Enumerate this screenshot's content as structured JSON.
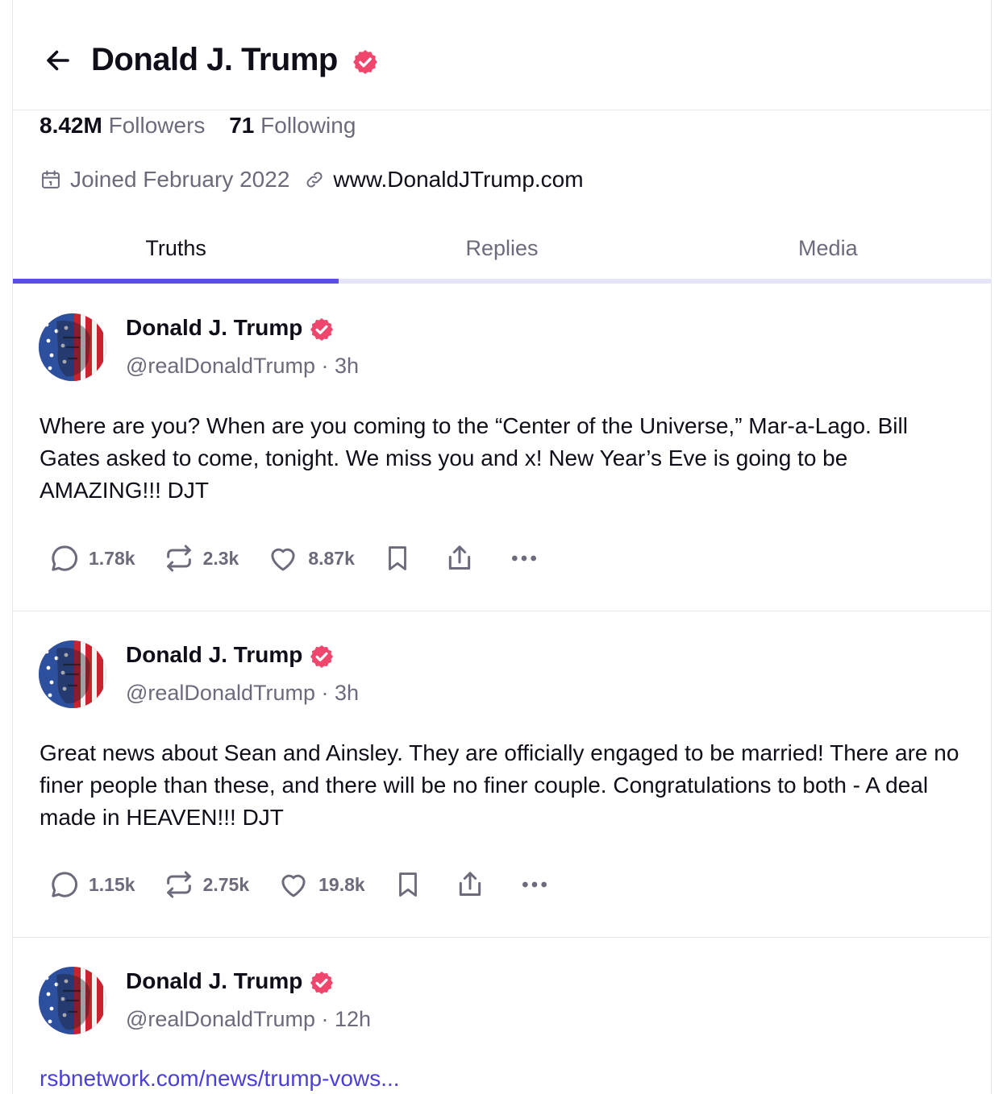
{
  "profile": {
    "display_name": "Donald J. Trump",
    "followers_count": "8.42M",
    "followers_label": "Followers",
    "following_count": "71",
    "following_label": "Following",
    "joined": "Joined February 2022",
    "website": "www.DonaldJTrump.com"
  },
  "tabs": [
    {
      "label": "Truths",
      "active": true
    },
    {
      "label": "Replies",
      "active": false
    },
    {
      "label": "Media",
      "active": false
    }
  ],
  "colors": {
    "accent": "#5b4fe0",
    "verified": "#f0456d",
    "link": "#4b3fd6"
  },
  "posts": [
    {
      "author": "Donald J. Trump",
      "handle_time": "@realDonaldTrump · 3h",
      "text": "Where are you? When are you coming to the “Center of the Universe,” Mar-a-Lago. Bill Gates asked to come, tonight. We miss you and x! New Year’s Eve is going to be AMAZING!!!  DJT",
      "replies": "1.78k",
      "retruths": "2.3k",
      "likes": "8.87k"
    },
    {
      "author": "Donald J. Trump",
      "handle_time": "@realDonaldTrump · 3h",
      "text": "Great news about Sean and Ainsley. They are officially engaged to be married! There are no finer people than these, and there will be no finer couple. Congratulations to both - A deal made in HEAVEN!!!  DJT",
      "replies": "1.15k",
      "retruths": "2.75k",
      "likes": "19.8k"
    },
    {
      "author": "Donald J. Trump",
      "handle_time": "@realDonaldTrump · 12h",
      "link": "rsbnetwork.com/news/trump-vows..."
    }
  ],
  "icons": [
    "arrow-left-icon",
    "verified-badge-icon",
    "calendar-icon",
    "link-icon",
    "reply-icon",
    "retruth-icon",
    "heart-icon",
    "bookmark-icon",
    "share-icon",
    "more-icon"
  ]
}
